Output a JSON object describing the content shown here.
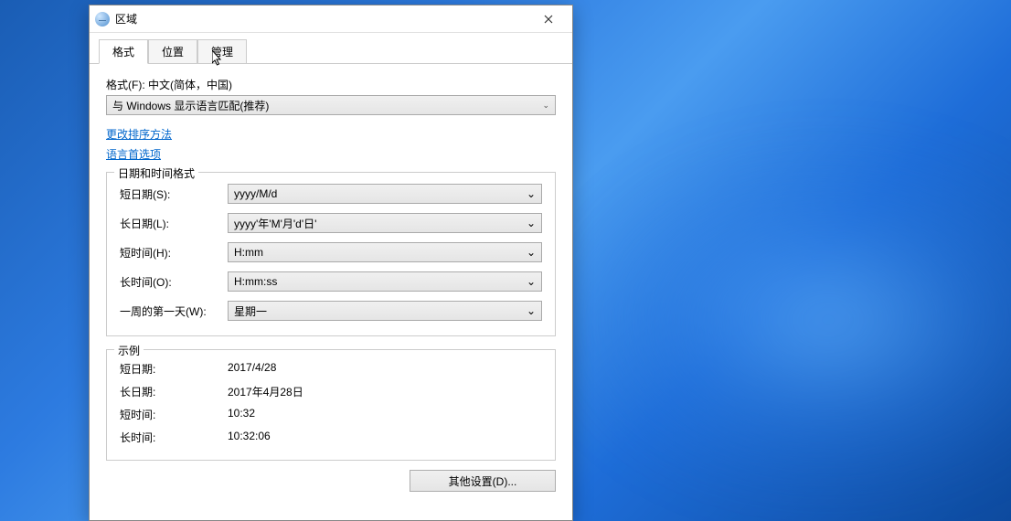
{
  "window": {
    "title": "区域"
  },
  "tabs": {
    "format": "格式",
    "location": "位置",
    "admin": "管理"
  },
  "format_section": {
    "label": "格式(F): 中文(简体，中国)",
    "dropdown_value": "与 Windows 显示语言匹配(推荐)"
  },
  "links": {
    "change_sort": "更改排序方法",
    "language_pref": "语言首选项"
  },
  "datetime_group": {
    "legend": "日期和时间格式",
    "short_date_label": "短日期(S):",
    "short_date_value": "yyyy/M/d",
    "long_date_label": "长日期(L):",
    "long_date_value": "yyyy'年'M'月'd'日'",
    "short_time_label": "短时间(H):",
    "short_time_value": "H:mm",
    "long_time_label": "长时间(O):",
    "long_time_value": "H:mm:ss",
    "first_day_label": "一周的第一天(W):",
    "first_day_value": "星期一"
  },
  "example_group": {
    "legend": "示例",
    "short_date_label": "短日期:",
    "short_date_value": "2017/4/28",
    "long_date_label": "长日期:",
    "long_date_value": "2017年4月28日",
    "short_time_label": "短时间:",
    "short_time_value": "10:32",
    "long_time_label": "长时间:",
    "long_time_value": "10:32:06"
  },
  "buttons": {
    "additional_settings": "其他设置(D)..."
  }
}
